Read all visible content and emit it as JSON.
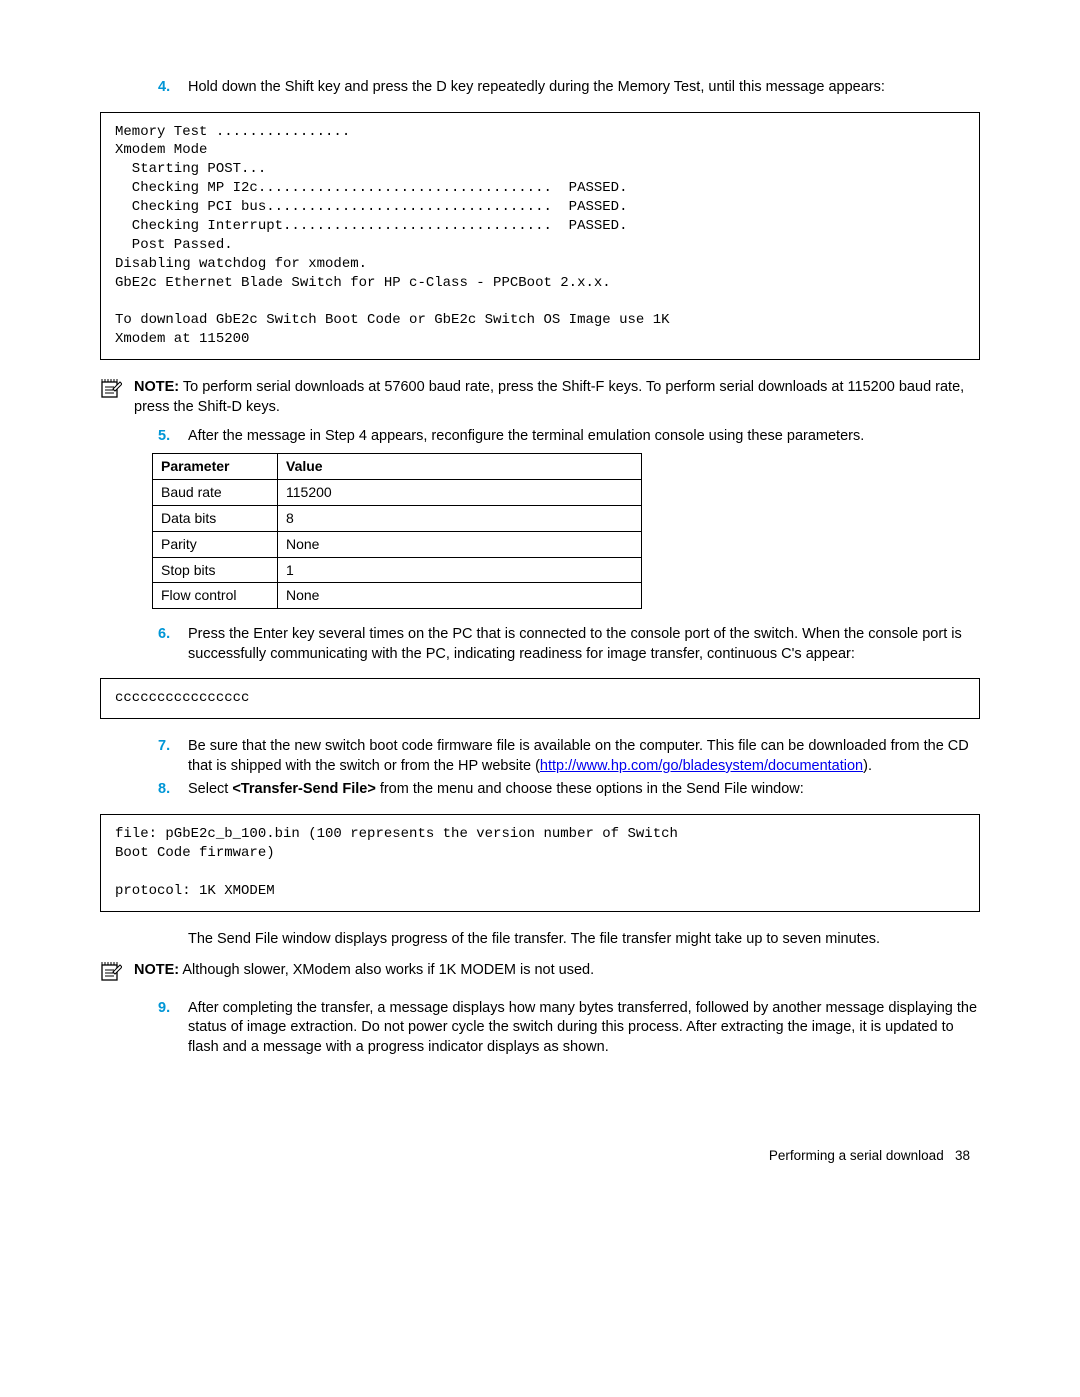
{
  "steps": {
    "s4": {
      "num": "4.",
      "text": "Hold down the Shift key and press the D key repeatedly during the Memory Test, until this message appears:",
      "code": "Memory Test ................\nXmodem Mode\n  Starting POST...\n  Checking MP I2c...................................  PASSED.\n  Checking PCI bus..................................  PASSED.\n  Checking Interrupt................................  PASSED.\n  Post Passed.\nDisabling watchdog for xmodem.\nGbE2c Ethernet Blade Switch for HP c-Class - PPCBoot 2.x.x.\n\nTo download GbE2c Switch Boot Code or GbE2c Switch OS Image use 1K\nXmodem at 115200"
    },
    "s5": {
      "num": "5.",
      "text": "After the message in Step 4 appears, reconfigure the terminal emulation console using these parameters."
    },
    "s6": {
      "num": "6.",
      "text": "Press the Enter key several times on the PC that is connected to the console port of the switch. When the console port is successfully communicating with the PC, indicating readiness for image transfer, continuous C's appear:",
      "code": "cccccccccccccccc"
    },
    "s7": {
      "num": "7.",
      "text_before": "Be sure that the new switch boot code firmware file is available on the computer. This file can be downloaded from the CD that is shipped with the switch or from the HP website (",
      "link": "http://www.hp.com/go/bladesystem/documentation",
      "text_after": ")."
    },
    "s8": {
      "num": "8.",
      "text_before": "Select ",
      "bold": "<Transfer-Send File>",
      "text_after": " from the menu and choose these options in the Send File window:",
      "code": "file: pGbE2c_b_100.bin (100 represents the version number of Switch\nBoot Code firmware)\n\nprotocol: 1K XMODEM",
      "follow": "The Send File window displays progress of the file transfer. The file transfer might take up to seven minutes."
    },
    "s9": {
      "num": "9.",
      "text": "After completing the transfer, a message displays how many bytes transferred, followed by another message displaying the status of image extraction. Do not power cycle the switch during this process. After extracting the image, it is updated to flash and a message with a progress indicator displays as shown."
    }
  },
  "notes": {
    "n1": {
      "label": "NOTE:",
      "text": "  To perform serial downloads at 57600 baud rate, press the Shift-F keys. To perform serial downloads at 115200 baud rate, press the Shift-D keys."
    },
    "n2": {
      "label": "NOTE:",
      "text": "  Although slower, XModem also works if 1K MODEM is not used."
    }
  },
  "table": {
    "headers": {
      "p": "Parameter",
      "v": "Value"
    },
    "rows": [
      {
        "p": "Baud rate",
        "v": "115200"
      },
      {
        "p": "Data bits",
        "v": "8"
      },
      {
        "p": "Parity",
        "v": "None"
      },
      {
        "p": "Stop bits",
        "v": "1"
      },
      {
        "p": "Flow control",
        "v": "None"
      }
    ]
  },
  "footer": {
    "section": "Performing a serial download",
    "page": "38"
  }
}
